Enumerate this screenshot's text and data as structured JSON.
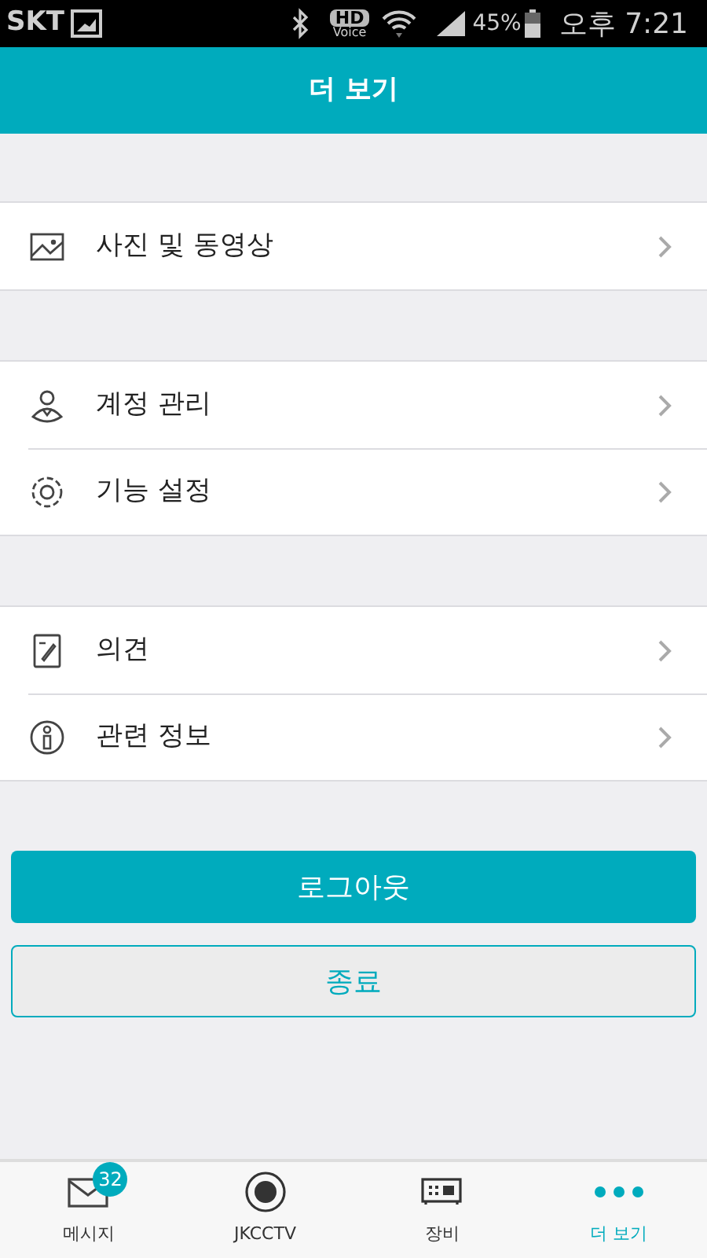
{
  "status_bar": {
    "carrier": "SKT",
    "hd": "HD",
    "voice": "Voice",
    "battery": "45%",
    "time": "오후 7:21"
  },
  "header": {
    "title": "더 보기"
  },
  "menu_groups": [
    {
      "items": [
        {
          "label": "사진 및 동영상"
        }
      ]
    },
    {
      "items": [
        {
          "label": "계정 관리"
        },
        {
          "label": "기능 설정"
        }
      ]
    },
    {
      "items": [
        {
          "label": "의견"
        },
        {
          "label": "관련 정보"
        }
      ]
    }
  ],
  "buttons": [
    {
      "label": "로그아웃",
      "kind": "primary"
    },
    {
      "label": "종료",
      "kind": "secondary"
    }
  ],
  "tab_bar": [
    {
      "label": "메시지",
      "badge": "32",
      "selected": false
    },
    {
      "label": "JKCCTV",
      "selected": false
    },
    {
      "label": "장비",
      "selected": false
    },
    {
      "label": "더 보기",
      "selected": true
    }
  ]
}
